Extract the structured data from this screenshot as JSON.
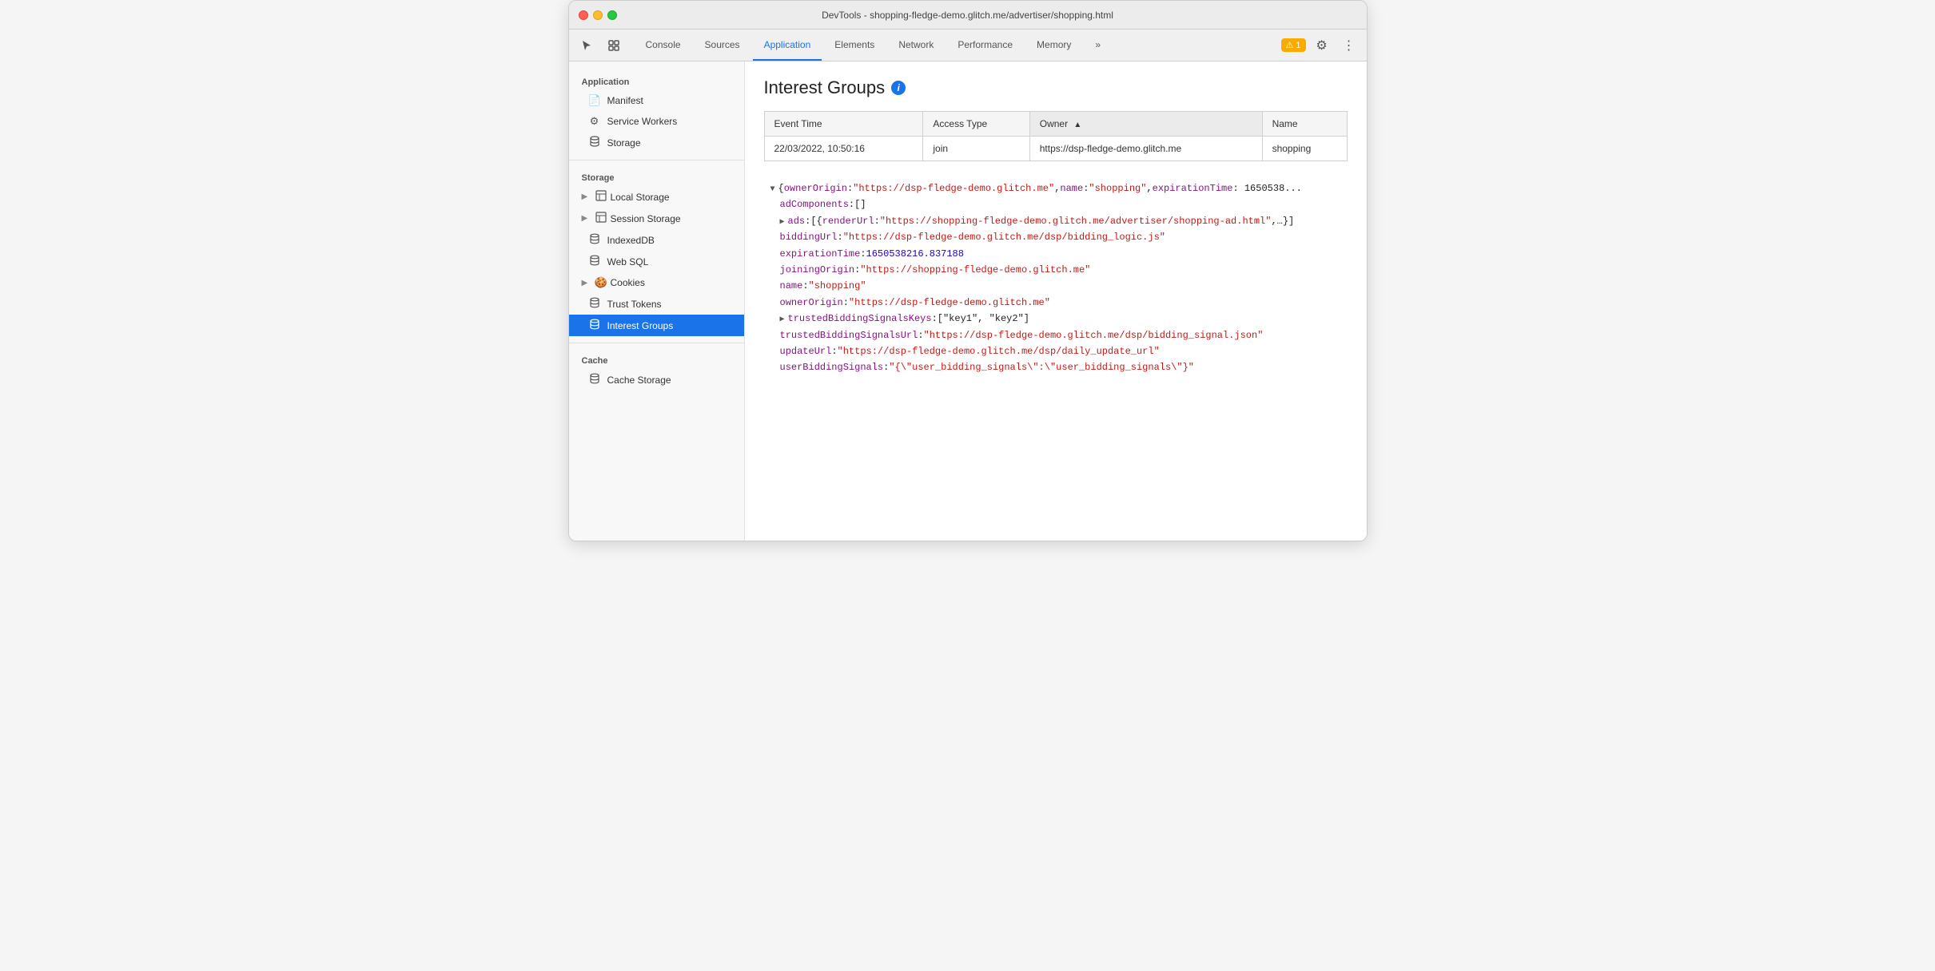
{
  "window": {
    "title": "DevTools - shopping-fledge-demo.glitch.me/advertiser/shopping.html"
  },
  "tabs": [
    {
      "id": "console",
      "label": "Console",
      "active": false
    },
    {
      "id": "sources",
      "label": "Sources",
      "active": false
    },
    {
      "id": "application",
      "label": "Application",
      "active": true
    },
    {
      "id": "elements",
      "label": "Elements",
      "active": false
    },
    {
      "id": "network",
      "label": "Network",
      "active": false
    },
    {
      "id": "performance",
      "label": "Performance",
      "active": false
    },
    {
      "id": "memory",
      "label": "Memory",
      "active": false
    }
  ],
  "toolbar": {
    "more_label": "»",
    "warning_count": "1",
    "warning_icon": "⚠"
  },
  "sidebar": {
    "app_section": "Application",
    "app_items": [
      {
        "id": "manifest",
        "label": "Manifest",
        "icon": "📄"
      },
      {
        "id": "service-workers",
        "label": "Service Workers",
        "icon": "⚙"
      },
      {
        "id": "storage",
        "label": "Storage",
        "icon": "🗄"
      }
    ],
    "storage_section": "Storage",
    "storage_items": [
      {
        "id": "local-storage",
        "label": "Local Storage",
        "icon": "▦",
        "expandable": true
      },
      {
        "id": "session-storage",
        "label": "Session Storage",
        "icon": "▦",
        "expandable": true
      },
      {
        "id": "indexeddb",
        "label": "IndexedDB",
        "icon": "🗄",
        "expandable": false
      },
      {
        "id": "web-sql",
        "label": "Web SQL",
        "icon": "🗄",
        "expandable": false
      },
      {
        "id": "cookies",
        "label": "Cookies",
        "icon": "🍪",
        "expandable": true
      },
      {
        "id": "trust-tokens",
        "label": "Trust Tokens",
        "icon": "🗄",
        "expandable": false
      },
      {
        "id": "interest-groups",
        "label": "Interest Groups",
        "icon": "🗄",
        "expandable": false,
        "active": true
      }
    ],
    "cache_section": "Cache",
    "cache_items": [
      {
        "id": "cache-storage",
        "label": "Cache Storage",
        "icon": "🗄",
        "expandable": false
      }
    ]
  },
  "content": {
    "title": "Interest Groups",
    "table": {
      "columns": [
        {
          "id": "event-time",
          "label": "Event Time",
          "sorted": false
        },
        {
          "id": "access-type",
          "label": "Access Type",
          "sorted": false
        },
        {
          "id": "owner",
          "label": "Owner",
          "sorted": true,
          "sort_dir": "▲"
        },
        {
          "id": "name",
          "label": "Name",
          "sorted": false
        }
      ],
      "rows": [
        {
          "event_time": "22/03/2022, 10:50:16",
          "access_type": "join",
          "owner": "https://dsp-fledge-demo.glitch.me",
          "name": "shopping"
        }
      ]
    },
    "json_tree": {
      "line1_prefix": "▼",
      "line1": "{ownerOrigin: \"https://dsp-fledge-demo.glitch.me\", name: \"shopping\", expirationTime: 1650538...",
      "adComponents_key": "adComponents",
      "adComponents_val": "[]",
      "ads_prefix": "▶",
      "ads_key": "ads",
      "ads_val": "[{renderUrl: \"https://shopping-fledge-demo.glitch.me/advertiser/shopping-ad.html\",…}]",
      "biddingUrl_key": "biddingUrl",
      "biddingUrl_val": "\"https://dsp-fledge-demo.glitch.me/dsp/bidding_logic.js\"",
      "expirationTime_key": "expirationTime",
      "expirationTime_val": "1650538216.837188",
      "joiningOrigin_key": "joiningOrigin",
      "joiningOrigin_val": "\"https://shopping-fledge-demo.glitch.me\"",
      "name_key": "name",
      "name_val": "\"shopping\"",
      "ownerOrigin_key": "ownerOrigin",
      "ownerOrigin_val": "\"https://dsp-fledge-demo.glitch.me\"",
      "trustedBiddingSignalsKeys_prefix": "▶",
      "trustedBiddingSignalsKeys_key": "trustedBiddingSignalsKeys",
      "trustedBiddingSignalsKeys_val": "[\"key1\", \"key2\"]",
      "trustedBiddingSignalsUrl_key": "trustedBiddingSignalsUrl",
      "trustedBiddingSignalsUrl_val": "\"https://dsp-fledge-demo.glitch.me/dsp/bidding_signal.json\"",
      "updateUrl_key": "updateUrl",
      "updateUrl_val": "\"https://dsp-fledge-demo.glitch.me/dsp/daily_update_url\"",
      "userBiddingSignals_key": "userBiddingSignals",
      "userBiddingSignals_val": "\"{\\\"user_bidding_signals\\\":\\\"user_bidding_signals\\\"}\""
    }
  }
}
